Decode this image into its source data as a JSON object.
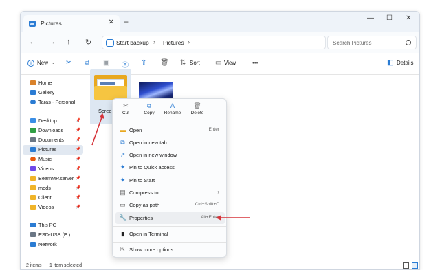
{
  "window": {
    "tab_title": "Pictures",
    "tab_close": "✕",
    "new_tab": "+",
    "minimize": "—",
    "maximize": "☐",
    "close": "✕"
  },
  "nav": {
    "back": "←",
    "forward": "→",
    "up": "↑",
    "refresh": "↻",
    "address": [
      "Start backup",
      "Pictures"
    ],
    "chevron": "›",
    "search_placeholder": "Search Pictures"
  },
  "toolbar": {
    "new_label": "New",
    "sort_label": "Sort",
    "view_label": "View",
    "more_label": "•••",
    "details_label": "Details",
    "icons": [
      "cut-icon",
      "copy-icon",
      "paste-icon",
      "rename-icon",
      "share-icon",
      "delete-icon"
    ]
  },
  "sidebar": {
    "items": [
      {
        "label": "Home",
        "color": "#d9822b"
      },
      {
        "label": "Gallery",
        "color": "#2b7cd3"
      },
      {
        "label": "Taras - Personal",
        "color": "#2b7cd3"
      },
      {
        "label": "Desktop",
        "color": "#3a8ee6"
      },
      {
        "label": "Downloads",
        "color": "#2f9e44"
      },
      {
        "label": "Documents",
        "color": "#6b7785"
      },
      {
        "label": "Pictures",
        "color": "#2b7cd3"
      },
      {
        "label": "Music",
        "color": "#e8590c"
      },
      {
        "label": "Videos",
        "color": "#7048e8"
      },
      {
        "label": "BeamMP.server",
        "color": "#f0b429"
      },
      {
        "label": "mods",
        "color": "#f0b429"
      },
      {
        "label": "Client",
        "color": "#f0b429"
      },
      {
        "label": "Videos",
        "color": "#f0b429"
      },
      {
        "label": "This PC",
        "color": "#2b7cd3"
      },
      {
        "label": "ESD-USB (E:)",
        "color": "#6b7785"
      },
      {
        "label": "Network",
        "color": "#2b7cd3"
      }
    ],
    "pin": "📌"
  },
  "content": {
    "folder_label": "Screen"
  },
  "status": {
    "items": "2 items",
    "selected": "1 item selected"
  },
  "context_menu": {
    "quick_actions": [
      {
        "label": "Cut",
        "icon": "✂"
      },
      {
        "label": "Copy",
        "icon": "⧉"
      },
      {
        "label": "Rename",
        "icon": "A"
      },
      {
        "label": "Delete",
        "icon": "🗑"
      }
    ],
    "items": [
      {
        "label": "Open",
        "shortcut": "Enter",
        "icon": "▬"
      },
      {
        "label": "Open in new tab",
        "shortcut": "",
        "icon": "⧉"
      },
      {
        "label": "Open in new window",
        "shortcut": "",
        "icon": "↗"
      },
      {
        "label": "Pin to Quick access",
        "shortcut": "",
        "icon": "✦"
      },
      {
        "label": "Pin to Start",
        "shortcut": "",
        "icon": "✦"
      },
      {
        "label": "Compress to...",
        "shortcut": "›",
        "icon": "▤"
      },
      {
        "label": "Copy as path",
        "shortcut": "Ctrl+Shift+C",
        "icon": "▭"
      },
      {
        "label": "Properties",
        "shortcut": "Alt+Enter",
        "icon": "🔧"
      },
      {
        "label": "Open in Terminal",
        "shortcut": "",
        "icon": "▮"
      },
      {
        "label": "Show more options",
        "shortcut": "",
        "icon": "⇱"
      }
    ]
  },
  "colors": {
    "accent": "#2b7cd3",
    "annotation_arrow": "#d6333a",
    "folder": "#f6c541"
  }
}
